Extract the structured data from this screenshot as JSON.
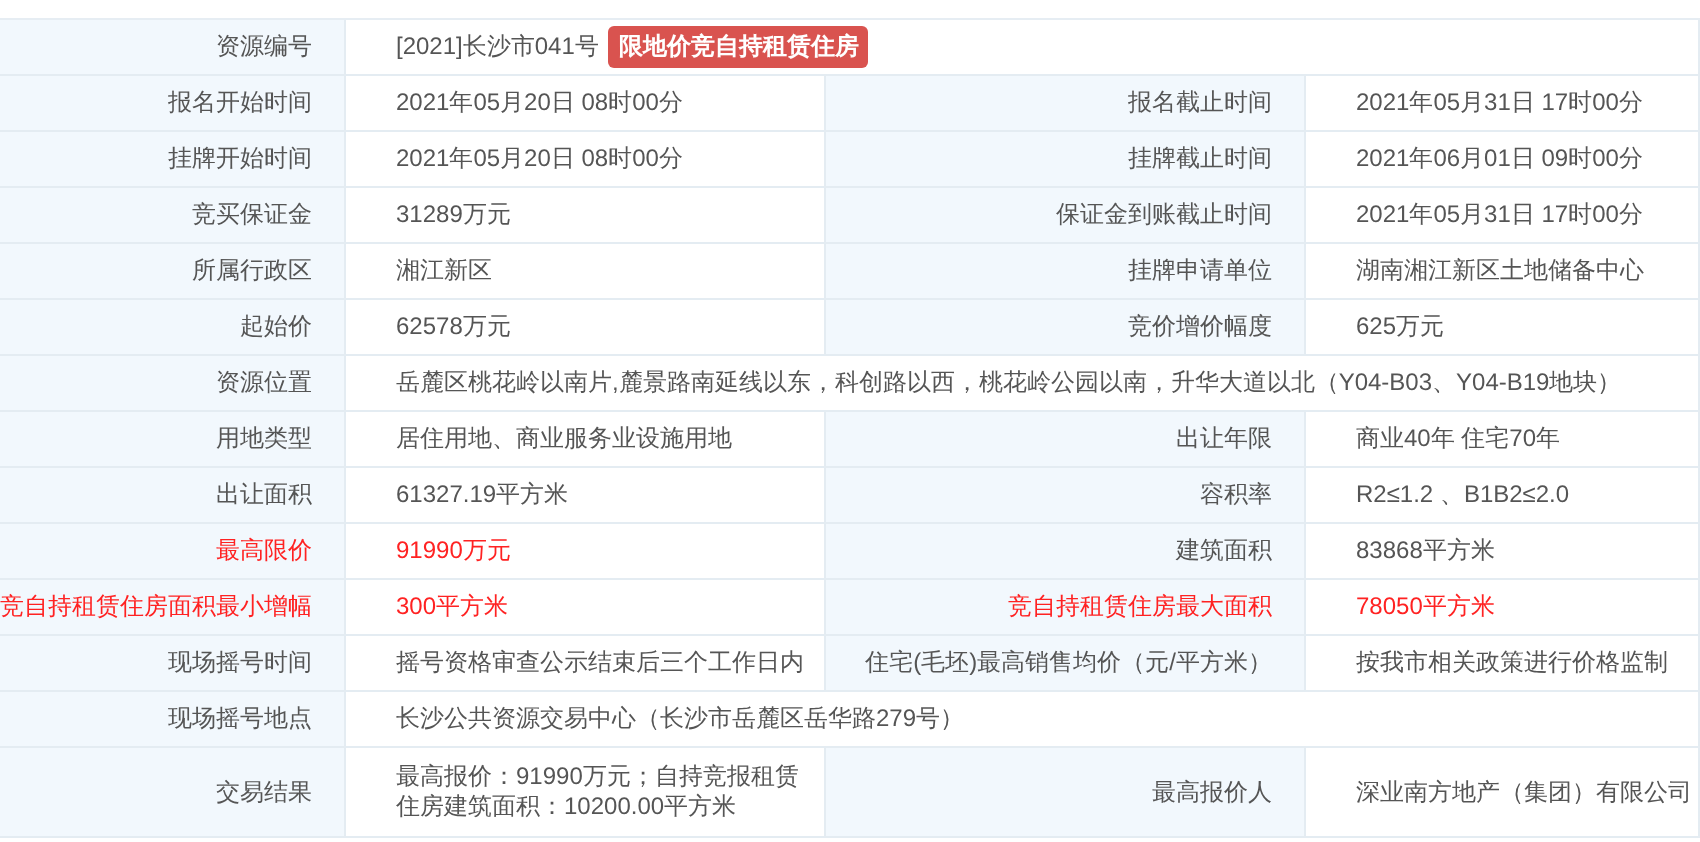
{
  "rows": [
    {
      "kind": "full",
      "cells": [
        {
          "label": "资源编号",
          "value": "[2021]长沙市041号",
          "badge": "限地价竞自持租赁住房",
          "highlight": false
        }
      ]
    },
    {
      "kind": "pair",
      "cells": [
        {
          "label": "报名开始时间",
          "value": "2021年05月20日 08时00分",
          "highlight": false
        },
        {
          "label": "报名截止时间",
          "value": "2021年05月31日 17时00分",
          "highlight": false
        }
      ]
    },
    {
      "kind": "pair",
      "cells": [
        {
          "label": "挂牌开始时间",
          "value": "2021年05月20日 08时00分",
          "highlight": false
        },
        {
          "label": "挂牌截止时间",
          "value": "2021年06月01日 09时00分",
          "highlight": false
        }
      ]
    },
    {
      "kind": "pair",
      "cells": [
        {
          "label": "竞买保证金",
          "value": "31289万元",
          "highlight": false
        },
        {
          "label": "保证金到账截止时间",
          "value": "2021年05月31日 17时00分",
          "highlight": false
        }
      ]
    },
    {
      "kind": "pair",
      "cells": [
        {
          "label": "所属行政区",
          "value": "湘江新区",
          "highlight": false
        },
        {
          "label": "挂牌申请单位",
          "value": "湖南湘江新区土地储备中心",
          "highlight": false
        }
      ]
    },
    {
      "kind": "pair",
      "cells": [
        {
          "label": "起始价",
          "value": "62578万元",
          "highlight": false
        },
        {
          "label": "竞价增价幅度",
          "value": "625万元",
          "highlight": false
        }
      ]
    },
    {
      "kind": "full",
      "cells": [
        {
          "label": "资源位置",
          "value": "岳麓区桃花岭以南片,麓景路南延线以东，科创路以西，桃花岭公园以南，升华大道以北（Y04-B03、Y04-B19地块）",
          "highlight": false
        }
      ]
    },
    {
      "kind": "pair",
      "cells": [
        {
          "label": "用地类型",
          "value": "居住用地、商业服务业设施用地",
          "highlight": false
        },
        {
          "label": "出让年限",
          "value": "商业40年 住宅70年",
          "highlight": false
        }
      ]
    },
    {
      "kind": "pair",
      "cells": [
        {
          "label": "出让面积",
          "value": "61327.19平方米",
          "highlight": false
        },
        {
          "label": "容积率",
          "value": "R2≤1.2 、B1B2≤2.0",
          "highlight": false
        }
      ]
    },
    {
      "kind": "pair",
      "cells": [
        {
          "label": "最高限价",
          "value": "91990万元",
          "highlight": true
        },
        {
          "label": "建筑面积",
          "value": "83868平方米",
          "highlight": false
        }
      ]
    },
    {
      "kind": "pair",
      "cells": [
        {
          "label": "竞自持租赁住房面积最小增幅",
          "value": "300平方米",
          "highlight": true
        },
        {
          "label": "竞自持租赁住房最大面积",
          "value": "78050平方米",
          "highlight": true
        }
      ]
    },
    {
      "kind": "pair",
      "cells": [
        {
          "label": "现场摇号时间",
          "value": "摇号资格审查公示结束后三个工作日内",
          "highlight": false
        },
        {
          "label": "住宅(毛坯)最高销售均价（元/平方米）",
          "value": "按我市相关政策进行价格监制",
          "highlight": false
        }
      ]
    },
    {
      "kind": "full",
      "cells": [
        {
          "label": "现场摇号地点",
          "value": "长沙公共资源交易中心（长沙市岳麓区岳华路279号）",
          "highlight": false
        }
      ]
    },
    {
      "kind": "pair",
      "cells": [
        {
          "label": "交易结果",
          "value": "最高报价：91990万元；自持竞报租赁住房建筑面积：10200.00平方米",
          "highlight": false
        },
        {
          "label": "最高报价人",
          "value": "深业南方地产（集团）有限公司",
          "highlight": false
        }
      ]
    }
  ]
}
